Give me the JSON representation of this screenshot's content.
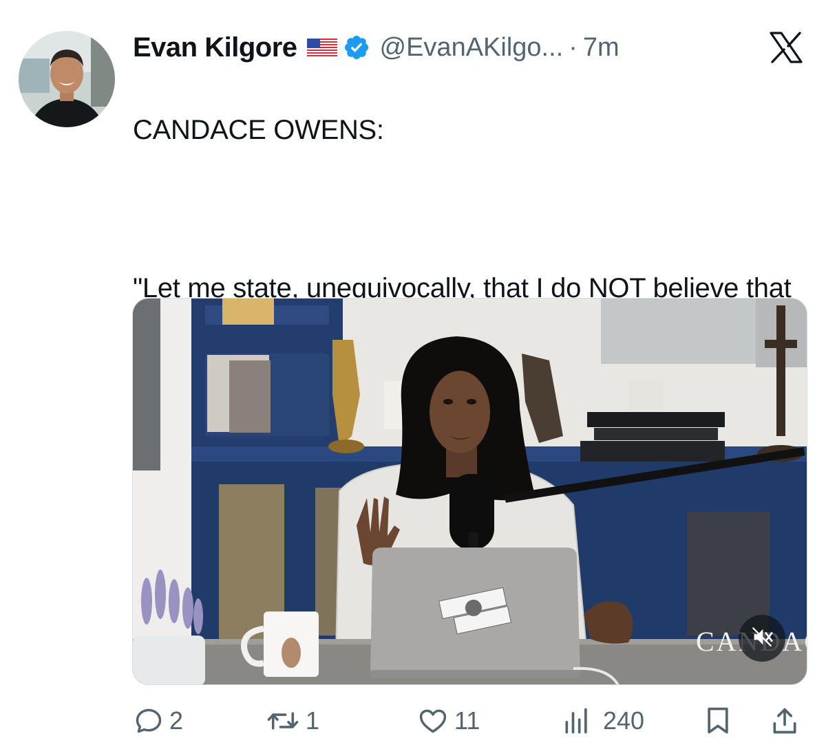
{
  "user": {
    "display_name": "Evan Kilgore",
    "handle": "@EvanAKilgo...",
    "separator": "·",
    "time": "7m",
    "flag_icon": "us-flag-emoji",
    "verified_icon": "verified-badge-icon"
  },
  "tweet": {
    "lines": [
      "CANDACE OWENS:",
      "",
      "\"Let me state, unequivocally, that I do NOT believe that Erika Kirk murdered her husband.\""
    ]
  },
  "media": {
    "watermark": "CANDACE",
    "mute_icon": "volume-muted-icon"
  },
  "actions": {
    "replies": "2",
    "reposts": "1",
    "likes": "11",
    "views": "240"
  },
  "colors": {
    "text_primary": "#0f1419",
    "text_secondary": "#536471",
    "verified_blue": "#1d9bf0"
  }
}
